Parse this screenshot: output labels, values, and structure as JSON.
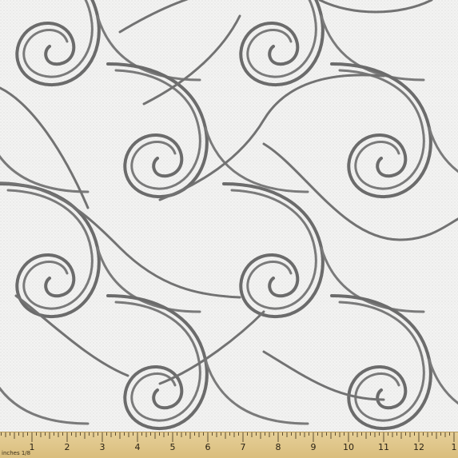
{
  "image": {
    "subject": "swirl-wave-fabric-swatch",
    "colors": {
      "background": "#f3f3f2",
      "stroke": "#7a7a7a",
      "stroke_shadow": "#5d5d5d",
      "ruler": "#e2c88c"
    }
  },
  "ruler": {
    "caption": "inches 1/8",
    "numbers": [
      "1",
      "2",
      "3",
      "4",
      "5",
      "6",
      "7",
      "8",
      "9",
      "10",
      "11",
      "12",
      "1"
    ]
  }
}
